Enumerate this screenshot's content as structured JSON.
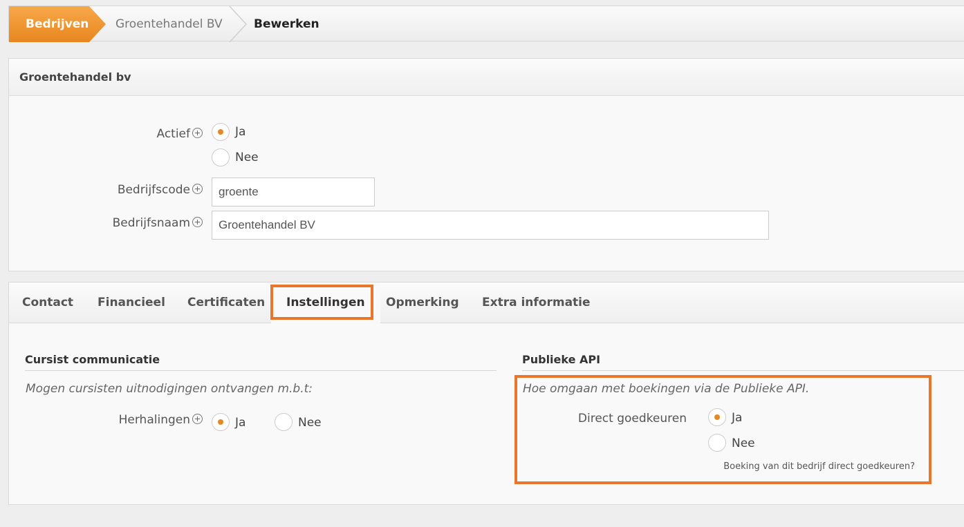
{
  "breadcrumb": {
    "items": [
      "Bedrijven",
      "Groentehandel BV",
      "Bewerken"
    ]
  },
  "company_panel": {
    "title": "Groentehandel bv",
    "actief_label": "Actief",
    "actief_options": [
      {
        "label": "Ja",
        "checked": true
      },
      {
        "label": "Nee",
        "checked": false
      }
    ],
    "bedrijfscode_label": "Bedrijfscode",
    "bedrijfscode_value": "groente",
    "bedrijfsnaam_label": "Bedrijfsnaam",
    "bedrijfsnaam_value": "Groentehandel BV"
  },
  "tabs": {
    "items": [
      "Contact",
      "Financieel",
      "Certificaten",
      "Instellingen",
      "Opmerking",
      "Extra informatie"
    ],
    "active": "Instellingen"
  },
  "cursist": {
    "title": "Cursist communicatie",
    "description": "Mogen cursisten uitnodigingen ontvangen m.b.t:",
    "herhalingen_label": "Herhalingen",
    "options": [
      {
        "label": "Ja",
        "checked": true
      },
      {
        "label": "Nee",
        "checked": false
      }
    ]
  },
  "api": {
    "title": "Publieke API",
    "description": "Hoe omgaan met boekingen via de Publieke API.",
    "direct_label": "Direct goedkeuren",
    "options": [
      {
        "label": "Ja",
        "checked": true
      },
      {
        "label": "Nee",
        "checked": false
      }
    ],
    "help": "Boeking van dit bedrijf direct goedkeuren?"
  },
  "colors": {
    "accent": "#e8861f",
    "highlight": "#e8772a"
  }
}
